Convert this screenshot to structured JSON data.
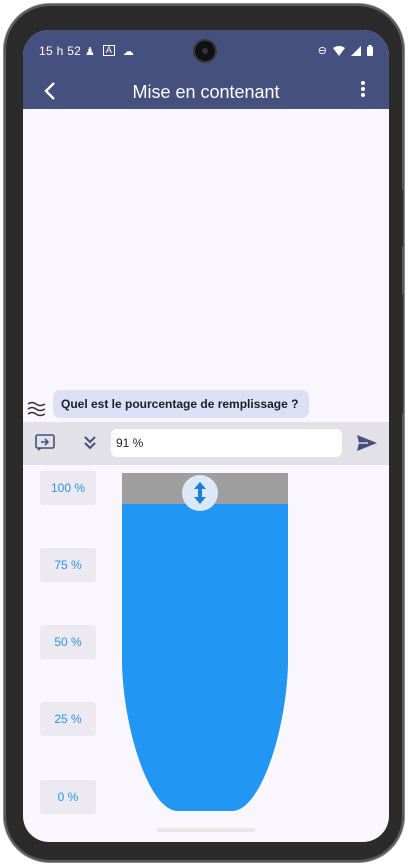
{
  "status": {
    "time": "15 h 52",
    "left_icons": [
      "person-icon",
      "a-box-icon",
      "cloud-icon"
    ],
    "right_icons": [
      "do-not-disturb-icon",
      "wifi-icon",
      "signal-icon",
      "battery-icon"
    ]
  },
  "appbar": {
    "title": "Mise en contenant",
    "back_icon": "chevron-left-icon",
    "menu_icon": "more-vert-icon"
  },
  "chat": {
    "question": "Quel est le pourcentage de remplissage ?",
    "bot_icon": "waves-icon"
  },
  "input": {
    "value": "91 %",
    "left_icon": "quick-reply-icon",
    "expand_icon": "double-chevron-down-icon",
    "send_icon": "send-icon"
  },
  "levels": [
    "100 %",
    "75 %",
    "50 %",
    "25 %",
    "0 %"
  ],
  "container": {
    "fill_percent": 91,
    "fill_color": "#2196F3",
    "empty_color": "#9E9E9E"
  },
  "colors": {
    "header": "#46507E",
    "background": "#FAF6FD",
    "accent": "#2796E6"
  }
}
